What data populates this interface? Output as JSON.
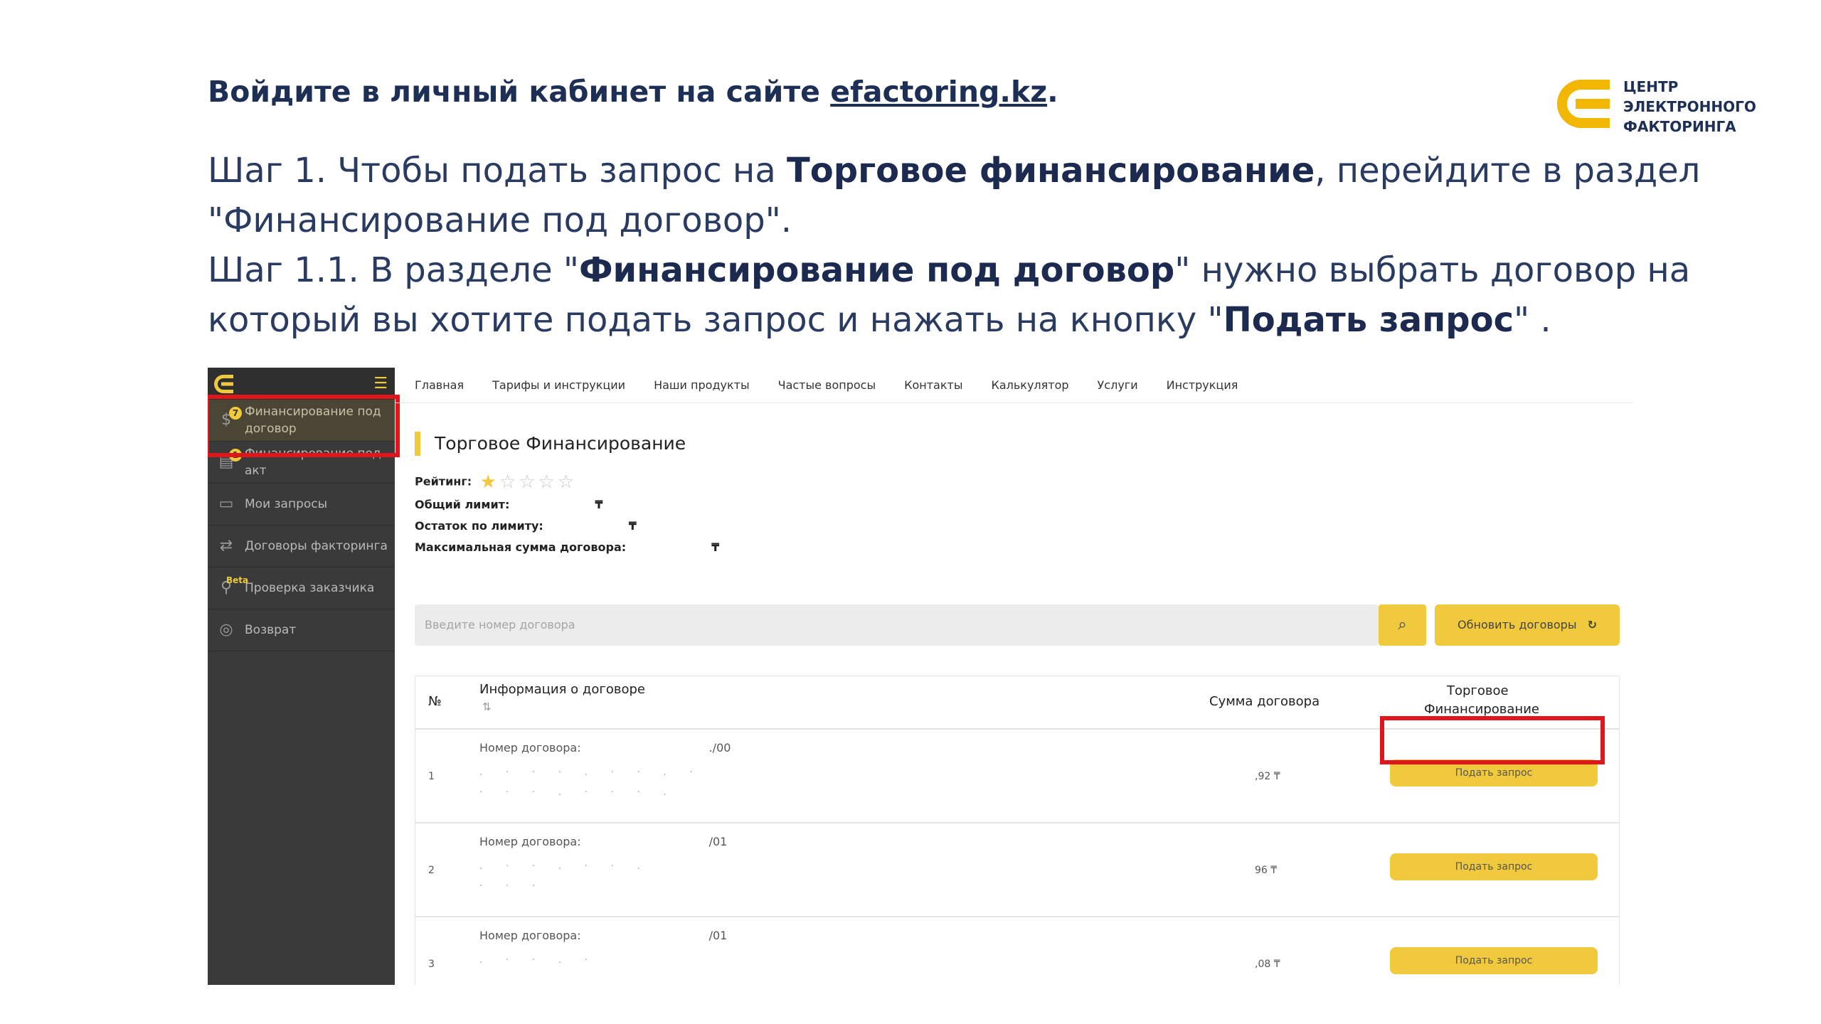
{
  "intro": {
    "text": "Войдите в личный кабинет на сайте ",
    "link": "efactoring.kz",
    "end": "."
  },
  "logo": {
    "line1": "ЦЕНТР",
    "line2": "ЭЛЕКТРОННОГО",
    "line3": "ФАКТОРИНГА"
  },
  "steps": {
    "s1_a": "Шаг 1.  Чтобы подать запрос на ",
    "s1_b": "Торговое финансирование",
    "s1_c": ", перейдите в раздел \"Финансирование под договор\".",
    "s2_a": "Шаг 1.1.  В разделе \"",
    "s2_b": "Финансирование под договор",
    "s2_c": "\" нужно выбрать договор на который вы хотите подать запрос и нажать на кнопку \"",
    "s2_d": "Подать запрос",
    "s2_e": "\" ."
  },
  "sidebar": {
    "items": [
      {
        "label": "Финансирование под договор",
        "icon": "money-icon",
        "badge": "7"
      },
      {
        "label": "Финансирование под акт",
        "icon": "document-list-icon",
        "badge": "1"
      },
      {
        "label": "Мои запросы",
        "icon": "document-icon"
      },
      {
        "label": "Договоры факторинга",
        "icon": "handshake-icon"
      },
      {
        "label": "Проверка заказчика",
        "icon": "user-search-icon",
        "tag": "Beta"
      },
      {
        "label": "Возврат",
        "icon": "coins-icon"
      }
    ]
  },
  "nav": [
    "Главная",
    "Тарифы и инструкции",
    "Наши продукты",
    "Частые вопросы",
    "Контакты",
    "Калькулятор",
    "Услуги",
    "Инструкция"
  ],
  "page": {
    "title": "Торговое Финансирование",
    "rating_label": "Рейтинг:",
    "rating": 1,
    "rating_max": 5,
    "limit_label": "Общий лимит:",
    "limit_currency": "₸",
    "remaining_label": "Остаток по лимиту:",
    "remaining_currency": "₸",
    "max_label": "Максимальная сумма договора:",
    "max_currency": "₸",
    "search_placeholder": "Введите номер договора",
    "refresh_label": "Обновить договоры"
  },
  "table": {
    "headers": {
      "num": "№",
      "info": "Информация о договоре",
      "sum": "Сумма договора",
      "tf_line1": "Торговое",
      "tf_line2": "Финансирование"
    },
    "rows": [
      {
        "num": "1",
        "label": "Номер договора:",
        "suffix": "./00",
        "sum": ",92 ₸",
        "button": "Подать запрос"
      },
      {
        "num": "2",
        "label": "Номер договора:",
        "suffix": "/01",
        "sum": "96 ₸",
        "button": "Подать запрос"
      },
      {
        "num": "3",
        "label": "Номер договора:",
        "suffix": "/01",
        "sum": ",08 ₸",
        "button": "Подать запрос"
      }
    ]
  },
  "colors": {
    "accent": "#f0c93c",
    "highlight": "#e0161b",
    "sidebar": "#3a3a3a",
    "text": "#1e2f55"
  }
}
